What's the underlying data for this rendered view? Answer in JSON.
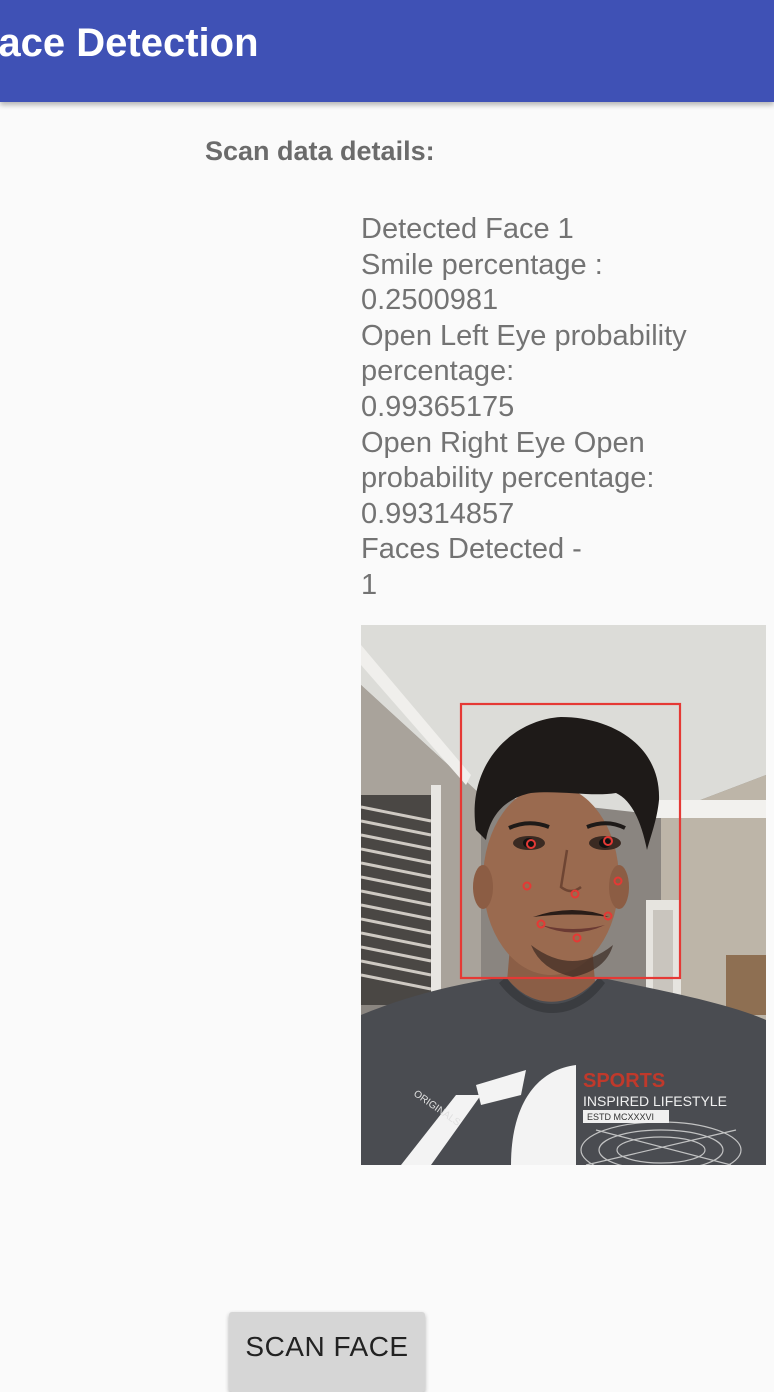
{
  "app_bar": {
    "title": "Face Detection",
    "color": "#3f51b5"
  },
  "scan": {
    "heading": "Scan data details:",
    "lines": [
      "Detected Face 1",
      "Smile percentage :",
      "0.2500981",
      "Open Left Eye probability",
      "percentage:",
      "0.99365175",
      "Open Right Eye Open",
      "probability percentage:",
      "0.99314857",
      "Faces Detected -",
      "1"
    ]
  },
  "image": {
    "shirt_text": {
      "line1": "SPORTS",
      "line2": "INSPIRED LIFESTYLE",
      "line3": "ESTD MCXXXVI",
      "line4": "ORIGINALS"
    },
    "overlay_color": "#e53935"
  },
  "actions": {
    "scan_button": "SCAN FACE"
  }
}
